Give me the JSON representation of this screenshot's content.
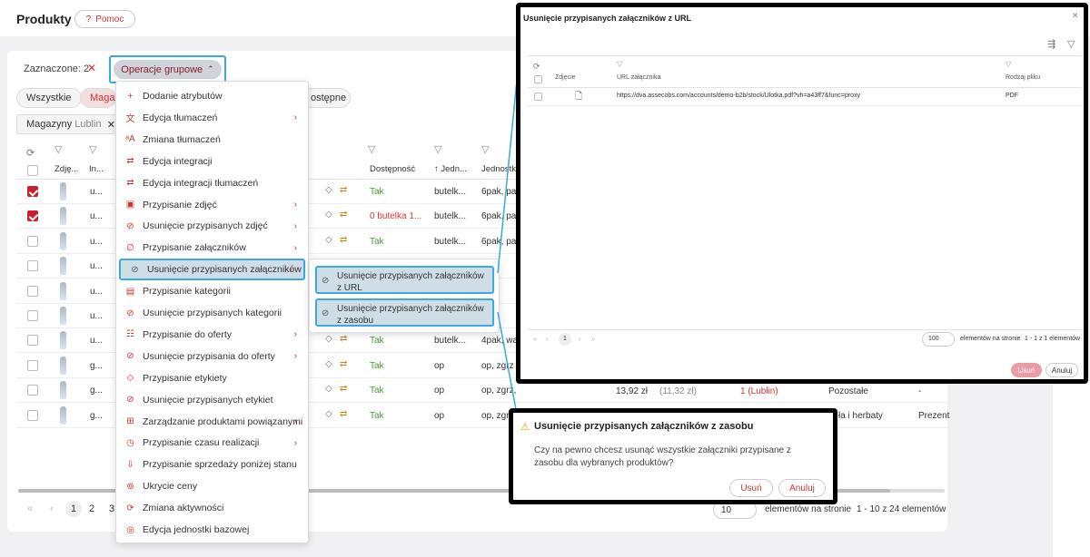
{
  "page": {
    "title": "Produkty",
    "help_label": "Pomoc"
  },
  "selection": {
    "label": "Zaznaczone: 2",
    "ops_label": "Operacje grupowe"
  },
  "filters": {
    "chip_all": "Wszystkie",
    "chip_mag": "Magaz",
    "chip_dost": "ostępne",
    "tag_label": "Magazyny",
    "tag_value": "Lublin"
  },
  "table": {
    "headers": [
      "Zdję...",
      "In...",
      "Dostępność",
      "↑ Jedn...",
      "Jednostk"
    ],
    "rows": [
      {
        "checked": true,
        "code": "u...",
        "dost": "Tak",
        "dost_red": false,
        "jedn": "butelk...",
        "jednostk": "6pak, pa"
      },
      {
        "checked": true,
        "code": "u...",
        "dost": "0 butelka 1...",
        "dost_red": true,
        "jedn": "butelk...",
        "jednostk": "6pak, pa"
      },
      {
        "checked": false,
        "code": "u...",
        "dost": "Tak",
        "dost_red": false,
        "jedn": "butelk...",
        "jednostk": "6pak, pa"
      },
      {
        "checked": false,
        "code": "u...",
        "dost": "",
        "dost_red": false,
        "jedn": "",
        "jednostk": ", pa"
      },
      {
        "checked": false,
        "code": "u...",
        "dost": "",
        "dost_red": false,
        "jedn": "",
        "jednostk": ", pa"
      },
      {
        "checked": false,
        "code": "u...",
        "dost": "",
        "dost_red": false,
        "jedn": "",
        "jednostk": ", pa"
      },
      {
        "checked": false,
        "code": "u...",
        "dost": "Tak",
        "dost_red": false,
        "jedn": "butelk...",
        "jednostk": "4pak, wa"
      },
      {
        "checked": false,
        "code": "g...",
        "dost": "Tak",
        "dost_red": false,
        "jedn": "op",
        "jednostk": "op, zgrz"
      },
      {
        "checked": false,
        "code": "g...",
        "dost": "Tak",
        "dost_red": false,
        "jedn": "op",
        "jednostk": "op, zgrz, kart"
      },
      {
        "checked": false,
        "code": "g...",
        "dost": "Tak",
        "dost_red": false,
        "jedn": "op",
        "jednostk": "op, zgrz"
      }
    ],
    "extra_row": {
      "price": "13,92 zł",
      "price_net": "(11,32 zł)",
      "warehouse": "1 (Lublin)",
      "category": "Pozostałe",
      "last": "-"
    },
    "extra_row2": {
      "category": "ła i herbaty",
      "last": "Prezent"
    }
  },
  "pagination": {
    "pages": [
      "1",
      "2",
      "3"
    ],
    "per_page": "10",
    "per_page_label": "elementów na stronie",
    "summary": "1 - 10 z 24 elementów"
  },
  "menu": {
    "items": [
      {
        "label": "Dodanie atrybutów",
        "icon": "plus-icon",
        "sub": false
      },
      {
        "label": "Edycja tłumaczeń",
        "icon": "translate-icon",
        "sub": true
      },
      {
        "label": "Zmiana tłumaczeń",
        "icon": "language-icon",
        "sub": false
      },
      {
        "label": "Edycja integracji",
        "icon": "swap-icon",
        "sub": false
      },
      {
        "label": "Edycja integracji tłumaczeń",
        "icon": "swap-icon",
        "sub": false
      },
      {
        "label": "Przypisanie zdjęć",
        "icon": "images-icon",
        "sub": true
      },
      {
        "label": "Usunięcie przypisanych zdjęć",
        "icon": "ban-icon",
        "sub": true
      },
      {
        "label": "Przypisanie załączników",
        "icon": "paperclip-icon",
        "sub": true
      },
      {
        "label": "Usunięcie przypisanych załączników",
        "icon": "ban-icon",
        "sub": true
      },
      {
        "label": "Przypisanie kategorii",
        "icon": "category-icon",
        "sub": false
      },
      {
        "label": "Usunięcie przypisanych kategorii",
        "icon": "ban-icon",
        "sub": false
      },
      {
        "label": "Przypisanie do oferty",
        "icon": "offer-icon",
        "sub": true
      },
      {
        "label": "Usunięcie przypisania do oferty",
        "icon": "ban-icon",
        "sub": true
      },
      {
        "label": "Przypisanie etykiety",
        "icon": "tag-icon",
        "sub": false
      },
      {
        "label": "Usunięcie przypisanych etykiet",
        "icon": "ban-icon",
        "sub": false
      },
      {
        "label": "Zarządzanie produktami powiązanymi",
        "icon": "link-icon",
        "sub": true
      },
      {
        "label": "Przypisanie czasu realizacji",
        "icon": "clock-icon",
        "sub": true
      },
      {
        "label": "Przypisanie sprzedaży poniżej stanu",
        "icon": "stock-icon",
        "sub": false
      },
      {
        "label": "Ukrycie ceny",
        "icon": "eye-off-icon",
        "sub": false
      },
      {
        "label": "Zmiana aktywności",
        "icon": "refresh-icon",
        "sub": false
      },
      {
        "label": "Edycja jednostki bazowej",
        "icon": "unit-icon",
        "sub": false
      }
    ]
  },
  "submenu": {
    "item1": "Usunięcie przypisanych załączników z URL",
    "item2": "Usunięcie przypisanych załączników z zasobu"
  },
  "dialog_url": {
    "title": "Usunięcie przypisanych załączników z URL",
    "col_photo": "Zdjęcie",
    "col_url": "URL załącznika",
    "col_type": "Rodzaj pliku",
    "row_url": "https://dva.assecobs.com/accounts/demo-b2b/stock/Ulotka.pdf?vh=a43ff7&func=proxy",
    "row_type": "PDF",
    "page": "1",
    "per_page": "100",
    "per_page_label": "elementów na stronie",
    "summary": "1 - 1 z 1 elementów",
    "delete_label": "Usuń",
    "cancel_label": "Anuluj"
  },
  "dialog_res": {
    "title": "Usunięcie przypisanych załączników z zasobu",
    "message": "Czy na pewno chcesz usunąć wszystkie załączniki przypisane z zasobu dla wybranych produktów?",
    "delete_label": "Usuń",
    "cancel_label": "Anuluj"
  },
  "colors": {
    "accent": "#c8202f",
    "highlight": "#3aa9e0",
    "selected_bg": "#cfdde6"
  }
}
